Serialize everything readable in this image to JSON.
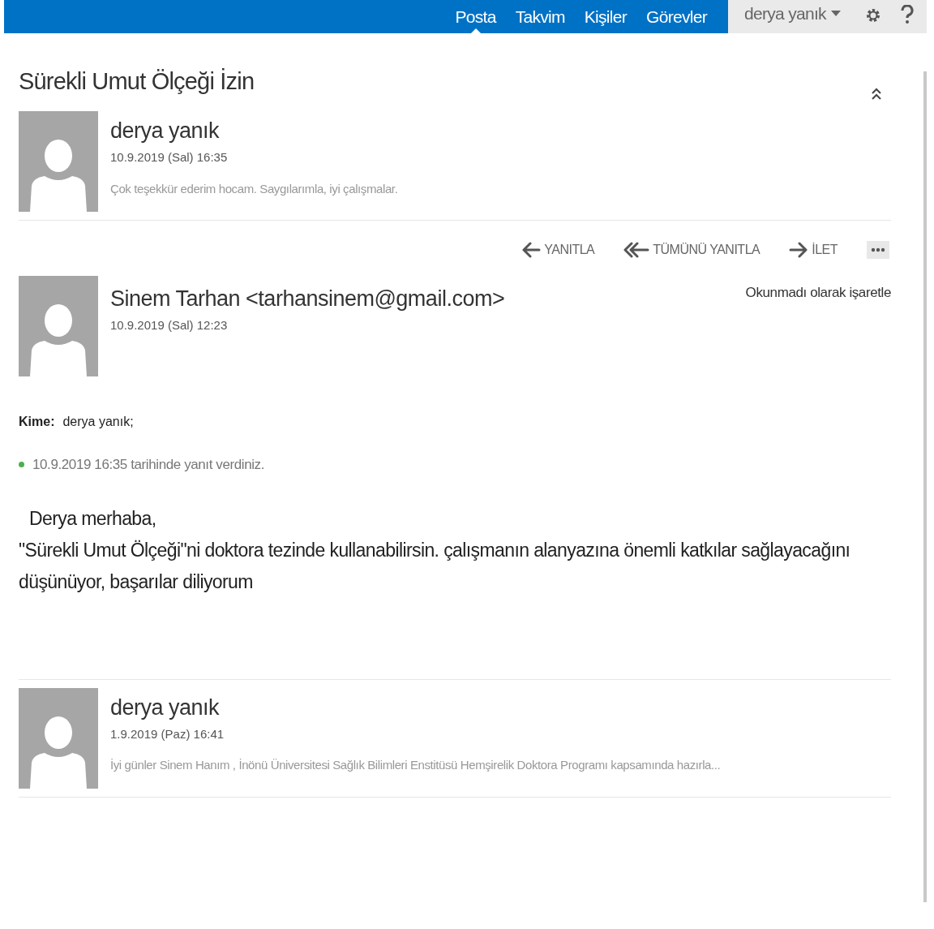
{
  "nav": {
    "items": [
      {
        "label": "Posta",
        "selected": true
      },
      {
        "label": "Takvim",
        "selected": false
      },
      {
        "label": "Kişiler",
        "selected": false
      },
      {
        "label": "Görevler",
        "selected": false
      }
    ],
    "user": "derya yanık"
  },
  "thread": {
    "title": "Sürekli Umut Ölçeği İzin",
    "messages": [
      {
        "kind": "collapsed",
        "sender": "derya yanık",
        "date": "10.9.2019 (Sal) 16:35",
        "preview": "Çok teşekkür ederim hocam. Saygılarımla, iyi çalışmalar."
      },
      {
        "kind": "expanded",
        "actions": [
          {
            "kind": "reply",
            "label": "YANITLA"
          },
          {
            "kind": "reply_all",
            "label": "TÜMÜNÜ YANITLA"
          },
          {
            "kind": "forward",
            "label": "İLET"
          },
          {
            "kind": "more"
          }
        ],
        "sender": "Sinem Tarhan <tarhansinem@gmail.com>",
        "date": "10.9.2019 (Sal) 12:23",
        "mark_unread": "Okunmadı olarak işaretle",
        "to_label": "Kime:",
        "to": "derya yanık;",
        "status": "10.9.2019 16:35 tarihinde yanıt verdiniz.",
        "body": [
          "Derya merhaba,",
          "\"Sürekli Umut Ölçeği\"ni doktora tezinde kullanabilirsin. çalışmanın alanyazına önemli katkılar sağlayacağını düşünüyor, başarılar diliyorum"
        ]
      },
      {
        "kind": "collapsed",
        "sender": "derya yanık",
        "date": "1.9.2019 (Paz) 16:41",
        "preview": "İyi günler Sinem Hanım , İnönü Üniversitesi Sağlık Bilimleri Enstitüsü Hemşirelik Doktora Programı kapsamında hazırla..."
      }
    ]
  }
}
